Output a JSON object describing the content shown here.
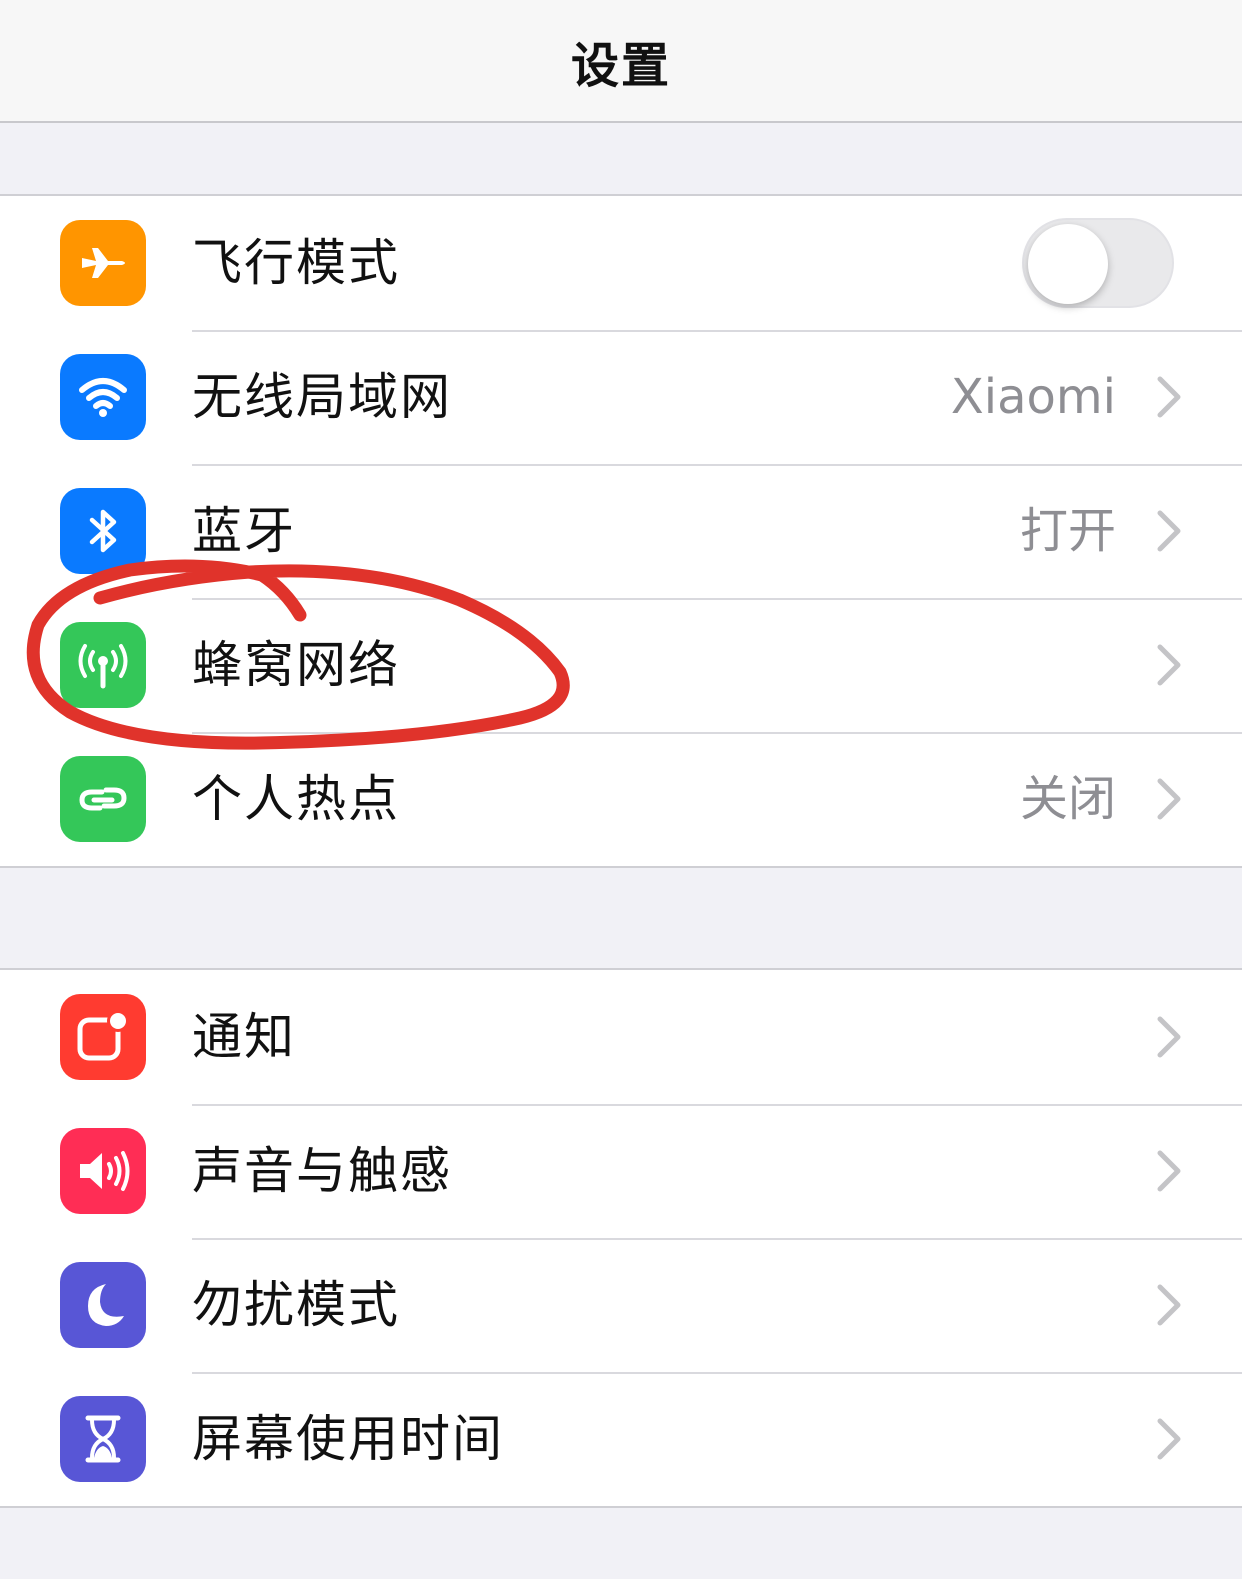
{
  "navbar": {
    "title": "设置"
  },
  "colors": {
    "airplane": "#ff9500",
    "wifi": "#0a7aff",
    "bluetooth": "#0a7aff",
    "cellular": "#34c759",
    "hotspot": "#34c759",
    "notifications": "#ff3b30",
    "sounds": "#ff2d55",
    "do_not_disturb": "#5856d6",
    "screen_time": "#5856d6",
    "annotation": "#e0332b"
  },
  "group1": {
    "items": [
      {
        "label": "飞行模式",
        "icon": "airplane-icon",
        "toggle_on": false
      },
      {
        "label": "无线局域网",
        "detail": "Xiaomi",
        "icon": "wifi-icon"
      },
      {
        "label": "蓝牙",
        "detail": "打开",
        "icon": "bluetooth-icon"
      },
      {
        "label": "蜂窝网络",
        "detail": "",
        "icon": "antenna-icon"
      },
      {
        "label": "个人热点",
        "detail": "关闭",
        "icon": "hotspot-link-icon"
      }
    ]
  },
  "group2": {
    "items": [
      {
        "label": "通知",
        "icon": "notification-badge-icon"
      },
      {
        "label": "声音与触感",
        "icon": "speaker-icon"
      },
      {
        "label": "勿扰模式",
        "icon": "moon-icon"
      },
      {
        "label": "屏幕使用时间",
        "icon": "hourglass-icon"
      }
    ]
  }
}
